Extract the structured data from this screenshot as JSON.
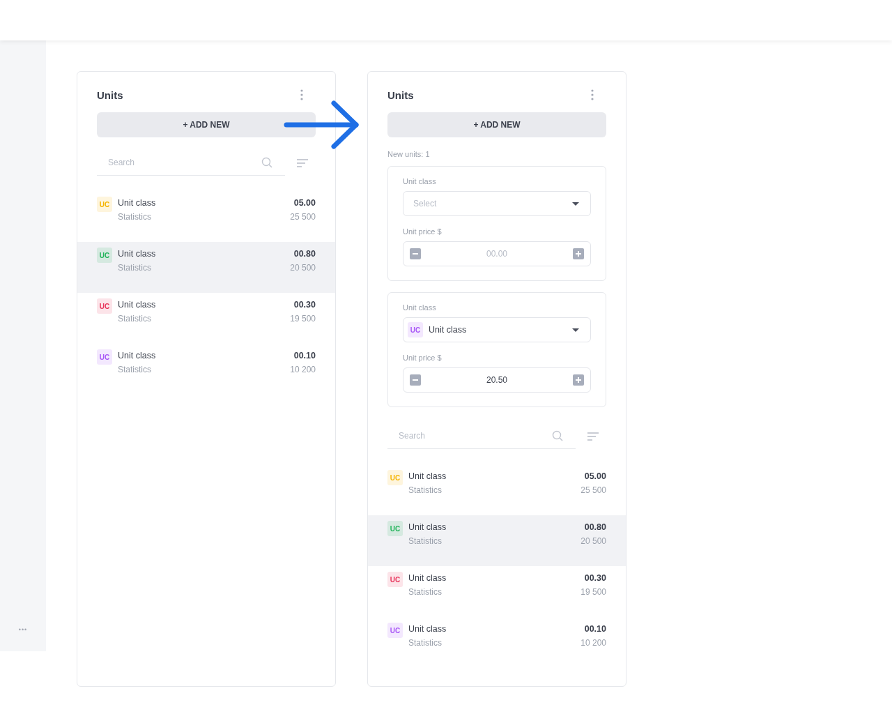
{
  "sidebar": {
    "more_label": "•••"
  },
  "panels": [
    {
      "title": "Units",
      "add_button": "+ ADD NEW",
      "search": {
        "placeholder": "Search"
      },
      "items": [
        {
          "badge": "UC",
          "color": "#f5b400",
          "name": "Unit class",
          "sub": "Statistics",
          "price": "05.00",
          "count": "25 500",
          "selected": false
        },
        {
          "badge": "UC",
          "color": "#22b45a",
          "name": "Unit class",
          "sub": "Statistics",
          "price": "00.80",
          "count": "20 500",
          "selected": true
        },
        {
          "badge": "UC",
          "color": "#e8335a",
          "name": "Unit class",
          "sub": "Statistics",
          "price": "00.30",
          "count": "19 500",
          "selected": false
        },
        {
          "badge": "UC",
          "color": "#a855f7",
          "name": "Unit class",
          "sub": "Statistics",
          "price": "00.10",
          "count": "10 200",
          "selected": false
        }
      ]
    },
    {
      "title": "Units",
      "add_button": "+ ADD NEW",
      "new_units": "New units: 1",
      "forms": [
        {
          "class_label": "Unit class",
          "select": {
            "placeholder": "Select"
          },
          "price_label": "Unit price $",
          "price": {
            "placeholder": "00.00"
          }
        },
        {
          "class_label": "Unit class",
          "select": {
            "badge": "UC",
            "color": "#a855f7",
            "value": "Unit class"
          },
          "price_label": "Unit price $",
          "price": {
            "value": "20.50"
          }
        }
      ],
      "search": {
        "placeholder": "Search"
      },
      "items": [
        {
          "badge": "UC",
          "color": "#f5b400",
          "name": "Unit class",
          "sub": "Statistics",
          "price": "05.00",
          "count": "25 500",
          "selected": false
        },
        {
          "badge": "UC",
          "color": "#22b45a",
          "name": "Unit class",
          "sub": "Statistics",
          "price": "00.80",
          "count": "20 500",
          "selected": true
        },
        {
          "badge": "UC",
          "color": "#e8335a",
          "name": "Unit class",
          "sub": "Statistics",
          "price": "00.30",
          "count": "19 500",
          "selected": false
        },
        {
          "badge": "UC",
          "color": "#a855f7",
          "name": "Unit class",
          "sub": "Statistics",
          "price": "00.10",
          "count": "10 200",
          "selected": false
        }
      ]
    }
  ]
}
